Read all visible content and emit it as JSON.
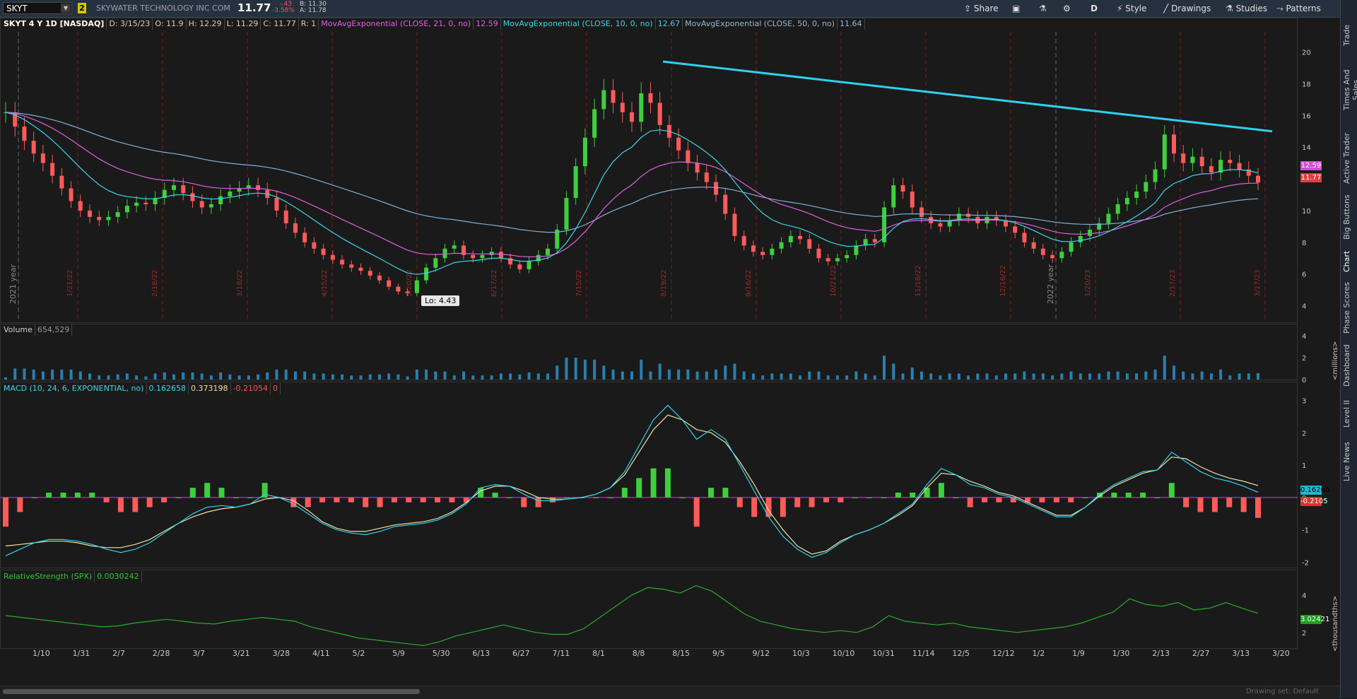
{
  "toolbar": {
    "symbol": "SKYT",
    "link_badge": "2",
    "company": "SKYWATER TECHNOLOGY INC COM",
    "last": "11.77",
    "change": "-.43",
    "change_pct": "-3.58%",
    "bid": "B: 11.30",
    "ask": "A: 11.78",
    "share": "Share",
    "period": "D",
    "style": "Style",
    "drawings": "Drawings",
    "studies": "Studies",
    "patterns": "Patterns"
  },
  "sidebar": [
    "Trade",
    "Times And Sales",
    "Active Trader",
    "Big Buttons",
    "Chart",
    "Phase Scores",
    "Dashboard",
    "Level II",
    "Live News"
  ],
  "price_header": {
    "title": "SKYT 4 Y 1D [NASDAQ]",
    "d": "D: 3/15/23",
    "o": "O: 11.9",
    "h": "H: 12.29",
    "l": "L: 11.29",
    "c": "C: 11.77",
    "r": "R: 1",
    "ma21": "MovAvgExponential (CLOSE, 21, 0, no)",
    "ma21_val": "12.59",
    "ma10": "MovAvgExponential (CLOSE, 10, 0, no)",
    "ma10_val": "12.67",
    "ma50": "MovAvgExponential (CLOSE, 50, 0, no)",
    "ma50_val": "11.64"
  },
  "volume_header": {
    "label": "Volume",
    "value": "654,529"
  },
  "macd_header": {
    "label": "MACD (10, 24, 6, EXPONENTIAL, no)",
    "v1": "0.162658",
    "v2": "0.373198",
    "v3": "-0.21054",
    "v4": "0"
  },
  "rs_header": {
    "label": "RelativeStrength (SPX)",
    "value": "0.0030242"
  },
  "tags": {
    "ma21": "12.59",
    "last": "11.77",
    "macd": "0.16266",
    "diff": "-0.2105",
    "rs": "3.02421"
  },
  "lo_label": "Lo: 4.43",
  "units": {
    "volume": "<millions>",
    "rs": "<thousandths>"
  },
  "footer": "Drawing set: Default",
  "year_labels": {
    "y2021": "2021 year",
    "y2022": "2022 year"
  },
  "event_dates": [
    "1/21/22",
    "2/18/22",
    "3/18/22",
    "4/15/22",
    "5/20/22",
    "6/17/22",
    "7/15/22",
    "8/19/22",
    "9/16/22",
    "10/21/22",
    "11/18/22",
    "12/16/22",
    "1/20/23",
    "2/17/23",
    "3/17/23"
  ],
  "colors": {
    "up": "#3ecf3e",
    "down": "#ff5a5a",
    "ma10": "#3ad8e6",
    "ma21": "#e060e0",
    "ma50": "#7fb0d8",
    "trend": "#30d0f0",
    "macd": "#30d0f0",
    "signal": "#f0e0a0",
    "rs": "#2ea82e"
  },
  "chart_data": {
    "type": "line",
    "x_ticks": [
      "1/10",
      "1/31",
      "2/7",
      "2/28",
      "3/7",
      "3/21",
      "3/28",
      "4/11",
      "5/2",
      "5/9",
      "5/30",
      "6/13",
      "6/27",
      "7/11",
      "8/1",
      "8/8",
      "8/15",
      "9/5",
      "9/12",
      "10/3",
      "10/10",
      "10/31",
      "11/14",
      "12/5",
      "12/12",
      "1/2",
      "1/9",
      "1/30",
      "2/13",
      "2/27",
      "3/13",
      "3/20"
    ],
    "price": {
      "y_ticks": [
        4,
        6,
        8,
        10,
        12,
        14,
        16,
        18,
        20
      ],
      "ylim": [
        3,
        21.5
      ],
      "close": [
        16.2,
        15.3,
        14.4,
        13.6,
        13.0,
        12.2,
        11.4,
        10.6,
        10.0,
        9.6,
        9.4,
        9.6,
        9.9,
        10.3,
        10.5,
        10.4,
        10.8,
        11.3,
        11.6,
        11.1,
        10.6,
        10.2,
        10.4,
        10.9,
        11.2,
        11.4,
        11.6,
        11.3,
        10.8,
        10.0,
        9.2,
        8.6,
        8.0,
        7.6,
        7.2,
        6.9,
        6.6,
        6.4,
        6.2,
        5.9,
        5.6,
        5.2,
        4.9,
        4.8,
        5.6,
        6.4,
        7.0,
        7.6,
        7.8,
        7.2,
        7.0,
        7.2,
        7.4,
        7.0,
        6.6,
        6.3,
        6.8,
        7.2,
        7.6,
        8.8,
        10.8,
        12.8,
        14.6,
        16.4,
        17.6,
        16.8,
        16.2,
        15.6,
        17.4,
        16.8,
        15.4,
        14.6,
        13.8,
        13.0,
        12.4,
        11.8,
        11.0,
        9.8,
        8.4,
        7.8,
        7.4,
        7.2,
        7.6,
        8.0,
        8.4,
        8.2,
        7.6,
        7.0,
        6.8,
        7.0,
        7.2,
        7.8,
        8.2,
        8.0,
        10.2,
        11.6,
        11.2,
        10.2,
        9.6,
        9.2,
        9.0,
        9.4,
        9.8,
        9.6,
        9.2,
        9.6,
        9.4,
        9.0,
        8.6,
        8.0,
        7.6,
        7.2,
        7.0,
        7.4,
        8.0,
        8.4,
        8.8,
        9.2,
        9.8,
        10.4,
        10.8,
        11.2,
        11.8,
        12.6,
        14.8,
        13.6,
        13.0,
        13.4,
        12.8,
        12.4,
        13.2,
        13.0,
        12.6,
        12.2,
        11.77
      ]
    },
    "volume": {
      "y_ticks": [
        0,
        2,
        4
      ],
      "unit": "millions"
    },
    "macd": {
      "y_ticks": [
        -2,
        -1,
        0,
        1,
        2,
        3
      ],
      "ylim": [
        -2.1,
        3.1
      ],
      "value": [
        -1.8,
        -1.6,
        -1.4,
        -1.3,
        -1.3,
        -1.35,
        -1.45,
        -1.6,
        -1.7,
        -1.6,
        -1.4,
        -1.1,
        -0.8,
        -0.5,
        -0.3,
        -0.25,
        -0.3,
        -0.2,
        0.1,
        0.0,
        -0.2,
        -0.5,
        -0.8,
        -1.0,
        -1.1,
        -1.15,
        -1.05,
        -0.9,
        -0.85,
        -0.8,
        -0.7,
        -0.5,
        -0.2,
        0.3,
        0.4,
        0.35,
        0.1,
        -0.1,
        -0.1,
        -0.05,
        0.0,
        0.1,
        0.3,
        0.8,
        1.6,
        2.4,
        2.85,
        2.4,
        1.8,
        2.1,
        1.8,
        1.0,
        0.2,
        -0.6,
        -1.2,
        -1.6,
        -1.85,
        -1.7,
        -1.4,
        -1.15,
        -1.0,
        -0.8,
        -0.5,
        -0.2,
        0.4,
        0.9,
        0.7,
        0.4,
        0.3,
        0.1,
        0.0,
        -0.2,
        -0.4,
        -0.6,
        -0.6,
        -0.3,
        0.1,
        0.4,
        0.6,
        0.8,
        0.85,
        1.4,
        1.1,
        0.8,
        0.6,
        0.5,
        0.35,
        0.16
      ],
      "signal": [
        -1.5,
        -1.45,
        -1.4,
        -1.35,
        -1.35,
        -1.4,
        -1.5,
        -1.55,
        -1.55,
        -1.45,
        -1.3,
        -1.05,
        -0.8,
        -0.6,
        -0.45,
        -0.35,
        -0.3,
        -0.2,
        -0.05,
        0.0,
        -0.1,
        -0.4,
        -0.75,
        -0.95,
        -1.05,
        -1.05,
        -0.95,
        -0.85,
        -0.8,
        -0.75,
        -0.65,
        -0.45,
        -0.15,
        0.2,
        0.35,
        0.35,
        0.2,
        0.0,
        -0.05,
        -0.05,
        0.0,
        0.1,
        0.3,
        0.7,
        1.4,
        2.1,
        2.55,
        2.4,
        2.1,
        2.0,
        1.7,
        1.1,
        0.4,
        -0.4,
        -1.0,
        -1.5,
        -1.75,
        -1.65,
        -1.35,
        -1.15,
        -1.0,
        -0.8,
        -0.55,
        -0.25,
        0.3,
        0.75,
        0.7,
        0.5,
        0.35,
        0.15,
        0.05,
        -0.15,
        -0.35,
        -0.55,
        -0.55,
        -0.3,
        0.05,
        0.35,
        0.55,
        0.75,
        0.85,
        1.25,
        1.2,
        0.95,
        0.75,
        0.6,
        0.5,
        0.37
      ]
    },
    "relative_strength": {
      "y_ticks": [
        2,
        4
      ],
      "unit": "thousandths",
      "ylim": [
        1.2,
        4.6
      ],
      "value": [
        2.9,
        2.8,
        2.7,
        2.6,
        2.5,
        2.4,
        2.3,
        2.35,
        2.5,
        2.6,
        2.7,
        2.6,
        2.5,
        2.45,
        2.6,
        2.7,
        2.8,
        2.7,
        2.6,
        2.3,
        2.1,
        1.9,
        1.7,
        1.6,
        1.5,
        1.4,
        1.3,
        1.5,
        1.8,
        2.0,
        2.2,
        2.4,
        2.2,
        2.0,
        1.9,
        1.9,
        2.2,
        2.8,
        3.4,
        4.0,
        4.4,
        4.3,
        4.1,
        4.5,
        4.2,
        3.6,
        3.0,
        2.6,
        2.4,
        2.2,
        2.1,
        2.0,
        2.1,
        2.0,
        2.3,
        2.9,
        2.6,
        2.5,
        2.4,
        2.5,
        2.3,
        2.2,
        2.1,
        2.0,
        2.1,
        2.2,
        2.3,
        2.5,
        2.8,
        3.1,
        3.8,
        3.5,
        3.4,
        3.6,
        3.2,
        3.3,
        3.6,
        3.3,
        3.02
      ]
    }
  }
}
